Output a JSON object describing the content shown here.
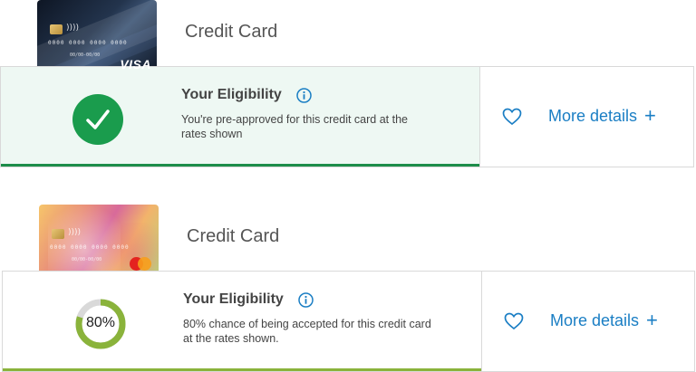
{
  "offers": [
    {
      "card_name": "Credit Card",
      "card_art": {
        "style": "dark-blue",
        "number": "0000 0000 0000 0000",
        "expiry": "00/00-00/00",
        "network": "VISA",
        "contactless_icon": "contactless-icon"
      },
      "eligibility": {
        "title": "Your Eligibility",
        "status": "pre-approved",
        "status_icon": "check-icon",
        "description": "You're pre-approved for this credit card at the rates shown",
        "accent_color": "#1d8d4a"
      },
      "actions": {
        "favourite_icon": "heart-icon",
        "more_details_label": "More details",
        "more_details_icon": "plus-icon"
      }
    },
    {
      "card_name": "Credit Card",
      "card_art": {
        "style": "colourful",
        "number": "0000 0000 0000 0000",
        "expiry": "00/00-00/00",
        "network": "mastercard",
        "contactless_icon": "contactless-icon"
      },
      "eligibility": {
        "title": "Your Eligibility",
        "status": "chance",
        "chance_percent": 80,
        "chance_label": "80%",
        "description": "80% chance of being accepted for this credit card at the rates shown.",
        "accent_color": "#8ab33b"
      },
      "actions": {
        "favourite_icon": "heart-icon",
        "more_details_label": "More details",
        "more_details_icon": "plus-icon"
      }
    }
  ],
  "colors": {
    "link": "#1a7ec4",
    "approved_green": "#1a9c4d",
    "approved_bg": "#eef8f3",
    "gauge_green": "#8ab33b",
    "gauge_track": "#d9d9d9",
    "border": "#d9d9d9"
  }
}
